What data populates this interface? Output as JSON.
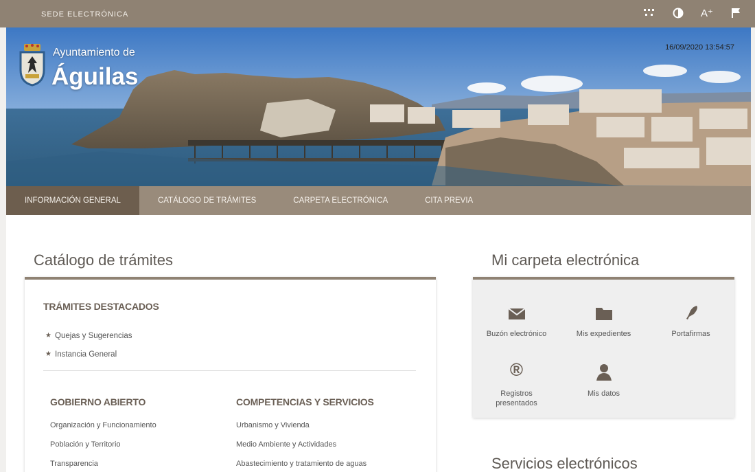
{
  "topbar": {
    "sede_label": "SEDE ELECTRÓNICA",
    "tools": [
      {
        "name": "sitemap-icon"
      },
      {
        "name": "contrast-icon"
      },
      {
        "name": "font-size-icon",
        "glyph": "A⁺"
      },
      {
        "name": "language-flag-icon"
      }
    ]
  },
  "header": {
    "brand_top": "Ayuntamiento de",
    "brand_name": "Águilas",
    "datetime": "16/09/2020 13:54:57"
  },
  "nav": {
    "items": [
      {
        "label": "INFORMACIÓN GENERAL",
        "active": true
      },
      {
        "label": "CATÁLOGO DE TRÁMITES",
        "active": false
      },
      {
        "label": "CARPETA ELECTRÓNICA",
        "active": false
      },
      {
        "label": "CITA PREVIA",
        "active": false
      }
    ]
  },
  "catalogo": {
    "title": "Catálogo de trámites",
    "destacados_heading": "TRÁMITES DESTACADOS",
    "destacados": [
      "Quejas y Sugerencias",
      "Instancia General"
    ],
    "col1": {
      "heading": "GOBIERNO ABIERTO",
      "links": [
        "Organización y Funcionamiento",
        "Población y Territorio",
        "Transparencia"
      ]
    },
    "col2": {
      "heading": "COMPETENCIAS Y SERVICIOS",
      "links": [
        "Urbanismo y Vivienda",
        "Medio Ambiente y Actividades",
        "Abastecimiento y tratamiento de aguas"
      ]
    }
  },
  "carpeta": {
    "title": "Mi carpeta electrónica",
    "items": [
      {
        "label": "Buzón electrónico",
        "icon": "envelope-icon"
      },
      {
        "label": "Mis expedientes",
        "icon": "folder-icon"
      },
      {
        "label": "Portafirmas",
        "icon": "pen-icon"
      },
      {
        "label": "Registros presentados",
        "icon": "registered-icon",
        "glyph": "®"
      },
      {
        "label": "Mis datos",
        "icon": "user-icon"
      }
    ]
  },
  "servicios": {
    "title": "Servicios electrónicos"
  },
  "colors": {
    "topbar": "#8f8273",
    "nav": "#998b7b",
    "nav_active": "#6d5e4e",
    "accent": "#8f8273"
  }
}
